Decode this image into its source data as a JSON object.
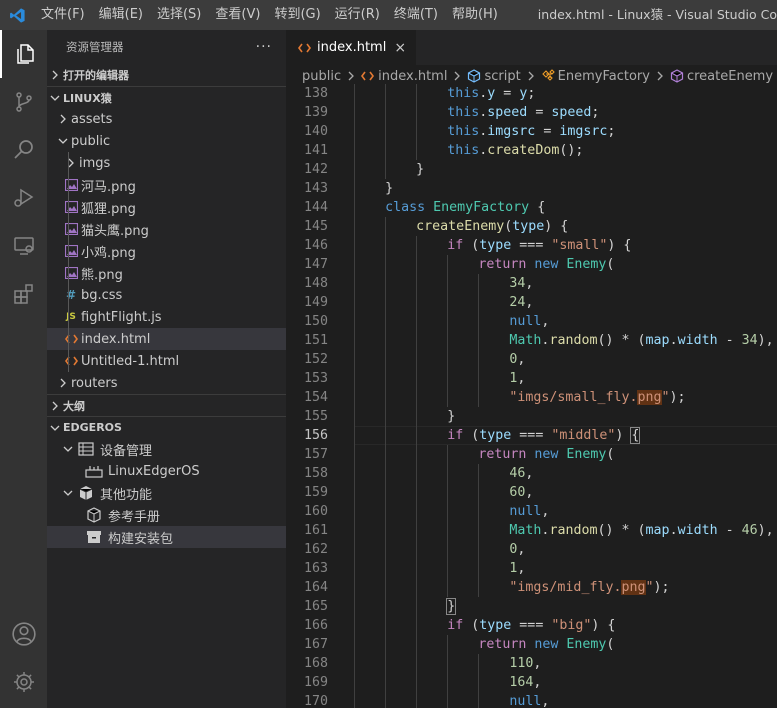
{
  "titlebar": {
    "menus": [
      "文件(F)",
      "编辑(E)",
      "选择(S)",
      "查看(V)",
      "转到(G)",
      "运行(R)",
      "终端(T)",
      "帮助(H)"
    ],
    "window_title": "index.html - Linux猿 - Visual Studio Co"
  },
  "activity_icons": [
    "files-icon",
    "source-control-icon",
    "search-icon",
    "run-debug-icon",
    "remote-explorer-icon",
    "extensions-icon",
    "account-icon",
    "settings-gear-icon"
  ],
  "sidebar": {
    "title": "资源管理器",
    "more": "···",
    "open_editors": "打开的编辑器",
    "workspace": "LINUX猿",
    "files": [
      {
        "label": "assets",
        "type": "folder",
        "depth": 1,
        "expanded": false
      },
      {
        "label": "public",
        "type": "folder",
        "depth": 1,
        "expanded": true
      },
      {
        "label": "imgs",
        "type": "folder",
        "depth": 2,
        "expanded": false
      },
      {
        "label": "河马.png",
        "type": "image",
        "depth": 2
      },
      {
        "label": "狐狸.png",
        "type": "image",
        "depth": 2
      },
      {
        "label": "猫头鹰.png",
        "type": "image",
        "depth": 2
      },
      {
        "label": "小鸡.png",
        "type": "image",
        "depth": 2
      },
      {
        "label": "熊.png",
        "type": "image",
        "depth": 2
      },
      {
        "label": "bg.css",
        "type": "css",
        "depth": 2
      },
      {
        "label": "fightFlight.js",
        "type": "js",
        "depth": 2
      },
      {
        "label": "index.html",
        "type": "html",
        "depth": 2,
        "selected": true
      },
      {
        "label": "Untitled-1.html",
        "type": "html",
        "depth": 2
      },
      {
        "label": "routers",
        "type": "folder",
        "depth": 1,
        "expanded": false
      }
    ],
    "outline": "大纲",
    "edgeros": "EDGEROS",
    "edgeros_items": [
      {
        "label": "设备管理",
        "depth": 1,
        "icon": "device-list-icon",
        "chevron": true
      },
      {
        "label": "LinuxEdgerOS",
        "depth": 2,
        "icon": "device-icon"
      },
      {
        "label": "其他功能",
        "depth": 1,
        "icon": "package-icon",
        "chevron": true
      },
      {
        "label": "参考手册",
        "depth": 2,
        "icon": "cube-icon"
      },
      {
        "label": "构建安装包",
        "depth": 2,
        "icon": "archive-icon",
        "selected": true
      }
    ]
  },
  "editor": {
    "tab_label": "index.html",
    "tab_close": "×",
    "breadcrumb": [
      "public",
      "index.html",
      "script",
      "EnemyFactory",
      "createEnemy"
    ],
    "current_line": 156,
    "lines": [
      {
        "n": 138,
        "i": 3,
        "t": [
          [
            "k",
            "this"
          ],
          [
            "p",
            "."
          ],
          [
            "v",
            "y"
          ],
          [
            "p",
            " = "
          ],
          [
            "v",
            "y"
          ],
          [
            "p",
            ";"
          ]
        ]
      },
      {
        "n": 139,
        "i": 3,
        "t": [
          [
            "k",
            "this"
          ],
          [
            "p",
            "."
          ],
          [
            "v",
            "speed"
          ],
          [
            "p",
            " = "
          ],
          [
            "v",
            "speed"
          ],
          [
            "p",
            ";"
          ]
        ]
      },
      {
        "n": 140,
        "i": 3,
        "t": [
          [
            "k",
            "this"
          ],
          [
            "p",
            "."
          ],
          [
            "v",
            "imgsrc"
          ],
          [
            "p",
            " = "
          ],
          [
            "v",
            "imgsrc"
          ],
          [
            "p",
            ";"
          ]
        ]
      },
      {
        "n": 141,
        "i": 3,
        "t": [
          [
            "k",
            "this"
          ],
          [
            "p",
            "."
          ],
          [
            "f",
            "createDom"
          ],
          [
            "p",
            "();"
          ]
        ]
      },
      {
        "n": 142,
        "i": 2,
        "t": [
          [
            "p",
            "}"
          ]
        ]
      },
      {
        "n": 143,
        "i": 1,
        "t": [
          [
            "p",
            "}"
          ]
        ]
      },
      {
        "n": 144,
        "i": 1,
        "t": [
          [
            "k",
            "class "
          ],
          [
            "t",
            "EnemyFactory"
          ],
          [
            "p",
            " {"
          ]
        ]
      },
      {
        "n": 145,
        "i": 2,
        "t": [
          [
            "f",
            "createEnemy"
          ],
          [
            "p",
            "("
          ],
          [
            "v",
            "type"
          ],
          [
            "p",
            ") {"
          ]
        ]
      },
      {
        "n": 146,
        "i": 3,
        "t": [
          [
            "kc",
            "if"
          ],
          [
            "p",
            " ("
          ],
          [
            "v",
            "type"
          ],
          [
            "p",
            " === "
          ],
          [
            "s",
            "\"small\""
          ],
          [
            "p",
            ") {"
          ]
        ]
      },
      {
        "n": 147,
        "i": 4,
        "t": [
          [
            "kc",
            "return "
          ],
          [
            "k",
            "new "
          ],
          [
            "t",
            "Enemy"
          ],
          [
            "p",
            "("
          ]
        ]
      },
      {
        "n": 148,
        "i": 5,
        "t": [
          [
            "n",
            "34"
          ],
          [
            "p",
            ","
          ]
        ]
      },
      {
        "n": 149,
        "i": 5,
        "t": [
          [
            "n",
            "24"
          ],
          [
            "p",
            ","
          ]
        ]
      },
      {
        "n": 150,
        "i": 5,
        "t": [
          [
            "k",
            "null"
          ],
          [
            "p",
            ","
          ]
        ]
      },
      {
        "n": 151,
        "i": 5,
        "t": [
          [
            "t",
            "Math"
          ],
          [
            "p",
            "."
          ],
          [
            "f",
            "random"
          ],
          [
            "p",
            "() * ("
          ],
          [
            "v",
            "map"
          ],
          [
            "p",
            "."
          ],
          [
            "v",
            "width"
          ],
          [
            "p",
            " - "
          ],
          [
            "n",
            "34"
          ],
          [
            "p",
            "),"
          ]
        ]
      },
      {
        "n": 152,
        "i": 5,
        "t": [
          [
            "n",
            "0"
          ],
          [
            "p",
            ","
          ]
        ]
      },
      {
        "n": 153,
        "i": 5,
        "t": [
          [
            "n",
            "1"
          ],
          [
            "p",
            ","
          ]
        ]
      },
      {
        "n": 154,
        "i": 5,
        "t": [
          [
            "s",
            "\"imgs/small_fly."
          ],
          [
            "sh",
            "png"
          ],
          [
            "s",
            "\""
          ],
          [
            "p",
            ");"
          ]
        ]
      },
      {
        "n": 155,
        "i": 3,
        "t": [
          [
            "p",
            "}"
          ]
        ]
      },
      {
        "n": 156,
        "i": 3,
        "t": [
          [
            "kc",
            "if"
          ],
          [
            "p",
            " ("
          ],
          [
            "v",
            "type"
          ],
          [
            "p",
            " === "
          ],
          [
            "s",
            "\"middle\""
          ],
          [
            "p",
            ") "
          ],
          [
            "pb",
            "{"
          ]
        ]
      },
      {
        "n": 157,
        "i": 4,
        "t": [
          [
            "kc",
            "return "
          ],
          [
            "k",
            "new "
          ],
          [
            "t",
            "Enemy"
          ],
          [
            "p",
            "("
          ]
        ]
      },
      {
        "n": 158,
        "i": 5,
        "t": [
          [
            "n",
            "46"
          ],
          [
            "p",
            ","
          ]
        ]
      },
      {
        "n": 159,
        "i": 5,
        "t": [
          [
            "n",
            "60"
          ],
          [
            "p",
            ","
          ]
        ]
      },
      {
        "n": 160,
        "i": 5,
        "t": [
          [
            "k",
            "null"
          ],
          [
            "p",
            ","
          ]
        ]
      },
      {
        "n": 161,
        "i": 5,
        "t": [
          [
            "t",
            "Math"
          ],
          [
            "p",
            "."
          ],
          [
            "f",
            "random"
          ],
          [
            "p",
            "() * ("
          ],
          [
            "v",
            "map"
          ],
          [
            "p",
            "."
          ],
          [
            "v",
            "width"
          ],
          [
            "p",
            " - "
          ],
          [
            "n",
            "46"
          ],
          [
            "p",
            "),"
          ]
        ]
      },
      {
        "n": 162,
        "i": 5,
        "t": [
          [
            "n",
            "0"
          ],
          [
            "p",
            ","
          ]
        ]
      },
      {
        "n": 163,
        "i": 5,
        "t": [
          [
            "n",
            "1"
          ],
          [
            "p",
            ","
          ]
        ]
      },
      {
        "n": 164,
        "i": 5,
        "t": [
          [
            "s",
            "\"imgs/mid_fly."
          ],
          [
            "sh",
            "png"
          ],
          [
            "s",
            "\""
          ],
          [
            "p",
            ");"
          ]
        ]
      },
      {
        "n": 165,
        "i": 3,
        "t": [
          [
            "pb",
            "}"
          ]
        ]
      },
      {
        "n": 166,
        "i": 3,
        "t": [
          [
            "kc",
            "if"
          ],
          [
            "p",
            " ("
          ],
          [
            "v",
            "type"
          ],
          [
            "p",
            " === "
          ],
          [
            "s",
            "\"big\""
          ],
          [
            "p",
            ") {"
          ]
        ]
      },
      {
        "n": 167,
        "i": 4,
        "t": [
          [
            "kc",
            "return "
          ],
          [
            "k",
            "new "
          ],
          [
            "t",
            "Enemy"
          ],
          [
            "p",
            "("
          ]
        ]
      },
      {
        "n": 168,
        "i": 5,
        "t": [
          [
            "n",
            "110"
          ],
          [
            "p",
            ","
          ]
        ]
      },
      {
        "n": 169,
        "i": 5,
        "t": [
          [
            "n",
            "164"
          ],
          [
            "p",
            ","
          ]
        ]
      },
      {
        "n": 170,
        "i": 5,
        "t": [
          [
            "k",
            "null"
          ],
          [
            "p",
            ","
          ]
        ]
      }
    ]
  }
}
